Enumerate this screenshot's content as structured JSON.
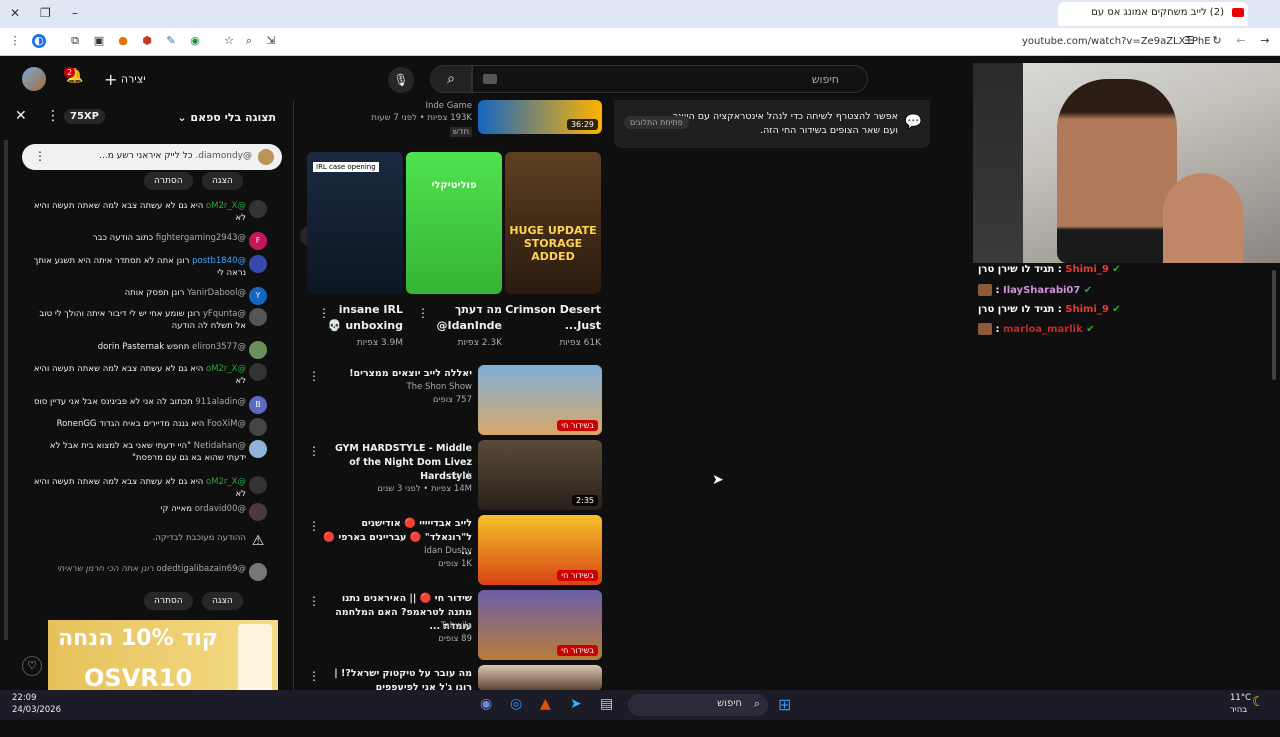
{
  "browser": {
    "tab_title": "(2) לייב משחקים אמונג אס עם",
    "url": "youtube.com/watch?v=Ze9aZLX1PhE"
  },
  "yt_header": {
    "search_placeholder": "חיפוש",
    "create_label": "יצירה",
    "notif_count": "2"
  },
  "chat": {
    "title": "תצוגה בלי ספאם",
    "xp_badge": "75XP",
    "pinned_author": "@diamondy.",
    "pinned_text": "כל לייק איראני רשע מ...",
    "show_label": "הצגה",
    "hide_label": "הסתרה",
    "messages": [
      {
        "author": "@oM2r_X",
        "text": "היא גם לא עשתה צבא למה שאתה תעשה והיא לא",
        "color": "green",
        "av": "#333",
        "initial": ""
      },
      {
        "author": "@fightergaming2943",
        "text": "כתוב הודעה כבר",
        "color": "",
        "av": "#c2185b",
        "initial": "F"
      },
      {
        "author": "@postb1840",
        "text": "רונן אתה לא תסתדר איתה היא תשגע אותך נראה לי",
        "color": "blue",
        "av": "#3949ab",
        "initial": ""
      },
      {
        "author": "@YanirDabool",
        "text": "רונן תפסק אותה",
        "color": "",
        "av": "#1565c0",
        "initial": "Y"
      },
      {
        "author": "@yFqunta",
        "text": "רונן שומע אחי יש לי דיבור איתה והולך לי טוב אל תשלח לה הודעה",
        "color": "",
        "av": "#555",
        "initial": ""
      },
      {
        "author": "@eliron3577",
        "text": "תחפש dorin Pasternak",
        "color": "",
        "av": "#6a8f5a",
        "initial": ""
      },
      {
        "author": "@oM2r_X",
        "text": "היא גם לא עשתה צבא למה שאתה תעשה והיא לא",
        "color": "green",
        "av": "#333",
        "initial": ""
      },
      {
        "author": "@911aladin",
        "text": "תכתוב לה אני לא פביגינס אבל אני עדיין סוס",
        "color": "",
        "av": "#5c6bc0",
        "initial": "B"
      },
      {
        "author": "@FooXiM",
        "text": "היא גננה מדיירים באיח הגדוד RonenGG",
        "color": "",
        "av": "#444",
        "initial": ""
      },
      {
        "author": "@Netidahan",
        "text": "\"היי ידעתי שאני בא למצוא בית אבל לא ידעתי שהוא בא גם עם מרפסת\"",
        "color": "",
        "av": "#8fb3d9",
        "initial": ""
      },
      {
        "author": "@oM2r_X",
        "text": "היא גם לא עשתה צבא למה שאתה תעשה והיא לא",
        "color": "green",
        "av": "#333",
        "initial": ""
      },
      {
        "author": "@ordavid00",
        "text": "מאייה קי",
        "color": "",
        "av": "#4a3a3a",
        "initial": ""
      }
    ],
    "warning_text": "ההודעה מעוכבת לבדיקה.",
    "held_author": "@odedtigalibazain69",
    "held_text": "רונן אתה הכי חרמן שראיתי",
    "promo_line1": "קוד 10% הנחה",
    "promo_line2": "OSVR10"
  },
  "top_video": {
    "channel": "Inde Game",
    "meta": "193K צפיות • לפני 7 שעות",
    "badge": "חדש",
    "duration": "36:29"
  },
  "shorts": [
    {
      "title": "Crimson Desert Just...",
      "views": "61K צפיות",
      "thumb_text": "HUGE UPDATE STORAGE ADDED"
    },
    {
      "title": "מה דעתך IdanInde@",
      "views": "2.3K צפיות",
      "thumb_text": "פוליטיקלי"
    },
    {
      "title": "insane IRL unboxing 💀",
      "views": "3.9M צפיות",
      "thumb_text": "IRL case opening"
    }
  ],
  "videos": [
    {
      "title": "יאללה לייב יוצאים ממצרים!",
      "channel": "The Shon Show",
      "meta": "757 צופים",
      "badge": "בשידור חי",
      "live": true
    },
    {
      "title": "GYM HARDSTYLE - Middle of the Night Dom Livez Hardstyle",
      "channel": "Lyck",
      "meta": "14M צפיות • לפני 3 שנים",
      "badge": "2:35",
      "live": false
    },
    {
      "title": "לייב אבדייייי 🔴 אודישנים ל\"רונאלד\" 🔴 עבריינים בארפי 🔴 ...",
      "channel": "Idan Dushy",
      "meta": "1K צופים",
      "badge": "בשידור חי",
      "live": true
    },
    {
      "title": "שידור חי 🔴 || האיראנים נתנו מתנה לטראמפ? האם המלחמה עומדת ...",
      "channel": "Tahwila",
      "meta": "89 צופים",
      "badge": "בשידור חי",
      "live": true
    },
    {
      "title": "מה עובר על טיקטוק ישראל?! | רונן ג'ל אני לפיעפפים",
      "channel": "",
      "meta": "",
      "badge": "",
      "live": false
    }
  ],
  "info_card": {
    "text": "אפשר להצטרף לשיחה כדי לנהל אינטראקציה עם היוצר ועם שאר הצופים בשידור החי הזה.",
    "button": "פתיחת התלונים"
  },
  "overlay_chat": [
    {
      "author": "Shimi_9",
      "text": "תגיד לו שירן טרן",
      "color": "#e53935"
    },
    {
      "author": "IlaySharabi07",
      "text": "",
      "color": "#ce93d8"
    },
    {
      "author": "Shimi_9",
      "text": "תגיד לו שירן טרן",
      "color": "#e53935"
    },
    {
      "author": "marloa_marlik",
      "text": "",
      "color": "#c62828"
    }
  ],
  "taskbar": {
    "time": "22:09",
    "date": "24/03/2026",
    "search": "חיפוש",
    "weather": "11°C",
    "weather_desc": "בהיר"
  }
}
